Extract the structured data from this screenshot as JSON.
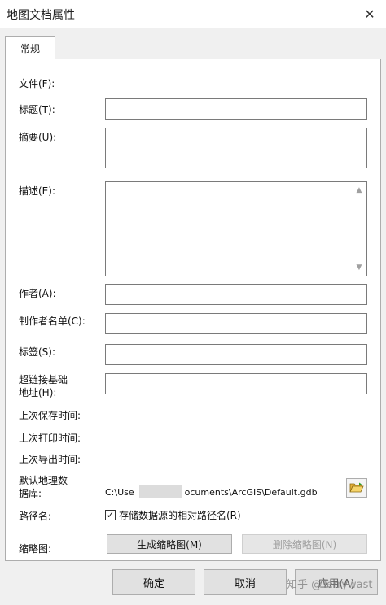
{
  "window": {
    "title": "地图文档属性",
    "close": "✕"
  },
  "tabs": [
    {
      "label": "常规"
    }
  ],
  "labels": {
    "file": "文件(F):",
    "title": "标题(T):",
    "summary": "摘要(U):",
    "description": "描述(E):",
    "author": "作者(A):",
    "credits": "制作者名单(C):",
    "tags": "标签(S):",
    "hyperlink_line1": "超链接基础",
    "hyperlink_line2": "地址(H):",
    "last_saved": "上次保存时间:",
    "last_printed": "上次打印时间:",
    "last_exported": "上次导出时间:",
    "default_gdb_line1": "默认地理数",
    "default_gdb_line2": "据库:",
    "pathnames": "路径名:",
    "thumbnail": "缩略图:"
  },
  "fields": {
    "title": "",
    "summary": "",
    "description": "",
    "author": "",
    "credits": "",
    "tags": "",
    "hyperlink": ""
  },
  "default_gdb": {
    "path_prefix": "C:\\Use",
    "path_suffix": "ocuments\\ArcGIS\\Default.gdb"
  },
  "pathnames_option": {
    "label": "存储数据源的相对路径名(R)",
    "checked": true
  },
  "buttons": {
    "make_thumbnail": "生成缩略图(M)",
    "delete_thumbnail": "删除缩略图(N)",
    "ok": "确定",
    "cancel": "取消",
    "apply": "应用(A)"
  },
  "watermark": "知乎 @Terrywast"
}
